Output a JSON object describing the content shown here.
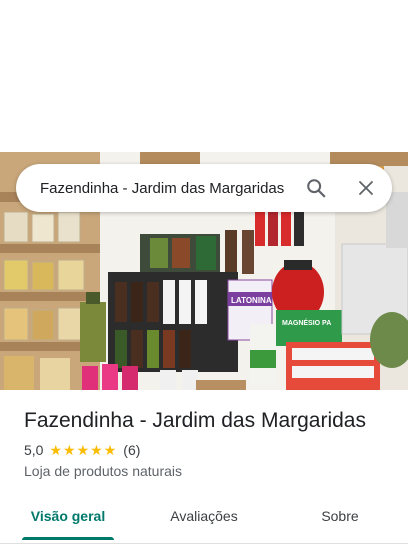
{
  "search": {
    "query": "Fazendinha - Jardim das Margaridas",
    "search_icon": "search-icon",
    "close_icon": "close-icon"
  },
  "place": {
    "name": "Fazendinha - Jardim das Margaridas",
    "rating": "5,0",
    "stars": 5,
    "review_count": "(6)",
    "category": "Loja de produtos naturais",
    "photo_sign_text": "LATONINA",
    "photo_box_text": "MAGNÉSIO PA"
  },
  "tabs": [
    {
      "label": "Visão geral",
      "active": true
    },
    {
      "label": "Avaliações",
      "active": false
    },
    {
      "label": "Sobre",
      "active": false
    }
  ],
  "colors": {
    "accent": "#00796b",
    "star": "#fbbc04"
  }
}
